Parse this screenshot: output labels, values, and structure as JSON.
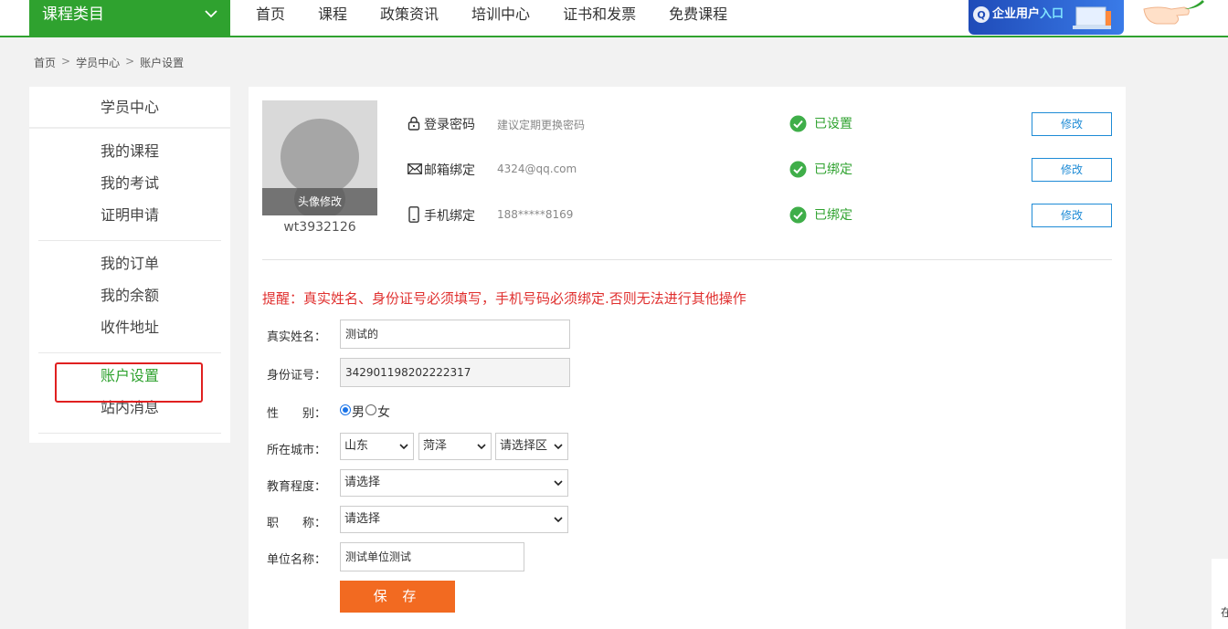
{
  "topbar": {
    "category_label": "课程类目",
    "nav": [
      "首页",
      "课程",
      "政策资讯",
      "培训中心",
      "证书和发票",
      "免费课程"
    ],
    "enterprise_prefix": "企业用户",
    "enterprise_entry": "入口"
  },
  "breadcrumb": [
    "首页",
    "学员中心",
    "账户设置"
  ],
  "breadcrumb_sep": ">",
  "sidebar": {
    "title": "学员中心",
    "groups": [
      [
        "我的课程",
        "我的考试",
        "证明申请"
      ],
      [
        "我的订单",
        "我的余额",
        "收件地址"
      ],
      [
        "账户设置",
        "站内消息"
      ]
    ]
  },
  "profile": {
    "avatar_edit": "头像修改",
    "username": "wt3932126"
  },
  "security": [
    {
      "label": "登录密码",
      "value": "建议定期更换密码",
      "status": "已设置",
      "action": "修改",
      "icon": "lock-icon"
    },
    {
      "label": "邮箱绑定",
      "value": "4324@qq.com",
      "status": "已绑定",
      "action": "修改",
      "icon": "mail-icon"
    },
    {
      "label": "手机绑定",
      "value": "188*****8169",
      "status": "已绑定",
      "action": "修改",
      "icon": "phone-icon"
    }
  ],
  "reminder": "提醒：真实姓名、身份证号必须填写，手机号码必须绑定.否则无法进行其他操作",
  "form": {
    "real_name_label": "真实姓名：",
    "real_name_value": "测试的",
    "id_label": "身份证号：",
    "id_value": "342901198202222317",
    "gender_label": "性　　别：",
    "gender_male": "男",
    "gender_female": "女",
    "city_label": "所在城市：",
    "province": "山东",
    "city": "菏泽",
    "district": "请选择区",
    "education_label": "教育程度：",
    "education_value": "请选择",
    "title_label": "职　　称：",
    "title_value": "请选择",
    "company_label": "单位名称：",
    "company_value": "测试单位测试",
    "save_label": "保 存"
  },
  "colors": {
    "brand_green": "#2fa22f",
    "save_orange": "#f26a21",
    "link_blue": "#1e8bd6",
    "warn_red": "#e0302f"
  },
  "edge_text": "在"
}
